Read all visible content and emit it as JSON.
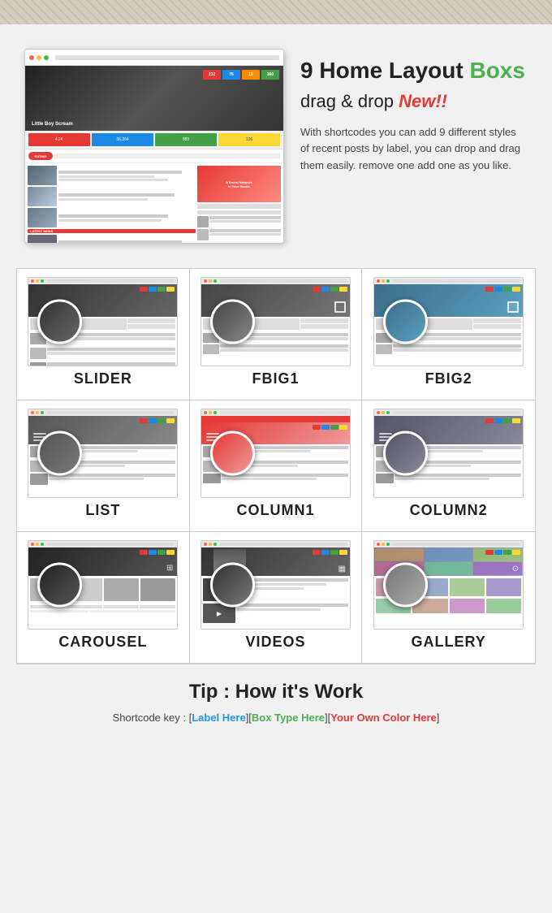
{
  "top_texture": {
    "visible": true
  },
  "hero": {
    "screenshot_alt": "Blog layout screenshot",
    "title_plain": "9 Home Layout ",
    "title_highlight": "Boxs",
    "subtitle_plain": "drag & drop  ",
    "subtitle_new": "New!!",
    "description": "With shortcodes you can add 9 different styles of recent posts by label, you can drop and drag them easily.\n remove one add one as you like."
  },
  "grid": {
    "rows": [
      {
        "cells": [
          {
            "id": "slider",
            "label": "SLIDER",
            "circle_class": "circle-slider",
            "icon": ""
          },
          {
            "id": "fbig1",
            "label": "FBIG1",
            "circle_class": "circle-fbig1",
            "icon": "□"
          },
          {
            "id": "fbig2",
            "label": "FBIG2",
            "circle_class": "circle-fbig2",
            "icon": "□"
          }
        ]
      },
      {
        "cells": [
          {
            "id": "list",
            "label": "LIST",
            "circle_class": "circle-list",
            "icon": "≡"
          },
          {
            "id": "column1",
            "label": "COLUMN1",
            "circle_class": "circle-col1",
            "icon": "≡"
          },
          {
            "id": "column2",
            "label": "COLUMN2",
            "circle_class": "circle-col2",
            "icon": "≡"
          }
        ]
      },
      {
        "cells": [
          {
            "id": "carousel",
            "label": "CAROUSEL",
            "circle_class": "circle-carousel",
            "icon": "⊞"
          },
          {
            "id": "videos",
            "label": "VIDEOS",
            "circle_class": "circle-videos",
            "icon": "▦"
          },
          {
            "id": "gallery",
            "label": "GALLERY",
            "circle_class": "circle-gallery",
            "icon": "⊙"
          }
        ]
      }
    ]
  },
  "tip": {
    "title": "Tip : How it's Work",
    "description_prefix": "Shortcode key : [",
    "key1": "Label Here",
    "key1_sep": "][",
    "key2": "Box Type Here",
    "key2_sep": "][",
    "key3": "Your Own Color Here",
    "description_suffix": "]"
  },
  "colors": {
    "highlight_green": "#4CAF50",
    "new_red": "#e53935",
    "key1_blue": "#2196F3",
    "key2_green": "#4CAF50",
    "key3_red": "#e53935"
  }
}
